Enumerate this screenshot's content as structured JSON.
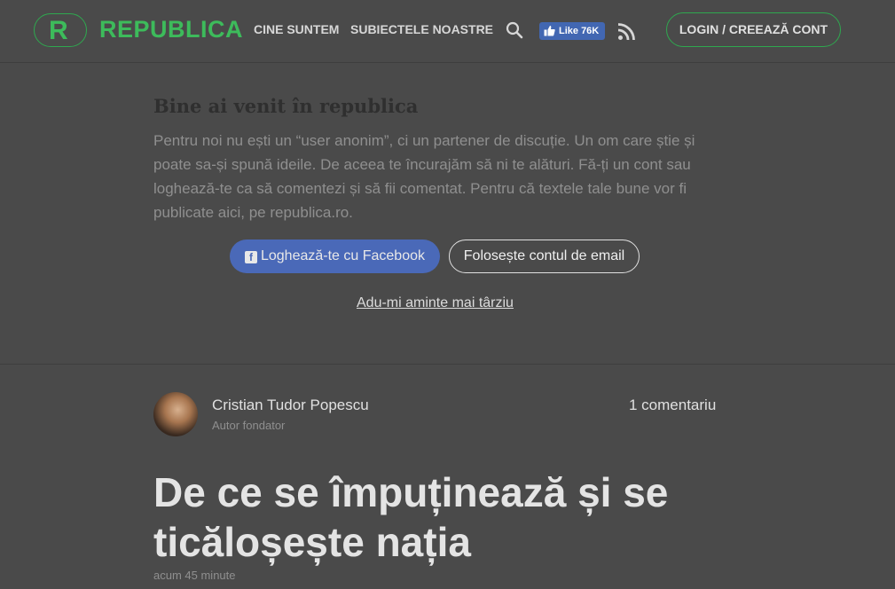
{
  "brand": {
    "logo_letter": "R",
    "name": "REPUBLICA",
    "accent": "#3dbb5b"
  },
  "nav": {
    "items": [
      {
        "label": "CINE SUNTEM"
      },
      {
        "label": "SUBIECTELE NOASTRE"
      }
    ],
    "search_icon": "search-icon",
    "fb_like": "Like 76K",
    "rss_icon": "rss-icon",
    "login_label": "LOGIN / CREEAZĂ CONT"
  },
  "welcome": {
    "title": "Bine ai venit în republica",
    "text": "Pentru noi nu ești un “user anonim”, ci un partener de discuție. Un om care știe și poate sa-și spună ideile. De aceea te încurajăm să ni te alături. Fă-ți un cont sau loghează-te ca să comentezi și să fii comentat. Pentru că textele tale bune vor fi publicate aici, pe republica.ro.",
    "facebook_button": "Loghează-te cu Facebook",
    "email_button": "Folosește contul de email",
    "later_link": "Adu-mi aminte mai târziu"
  },
  "article": {
    "author_name": "Cristian Tudor Popescu",
    "author_role": "Autor fondator",
    "comments": "1 comentariu",
    "headline": "De ce se împuținează și se ticăloșește nația",
    "time": "acum 45 minute"
  }
}
